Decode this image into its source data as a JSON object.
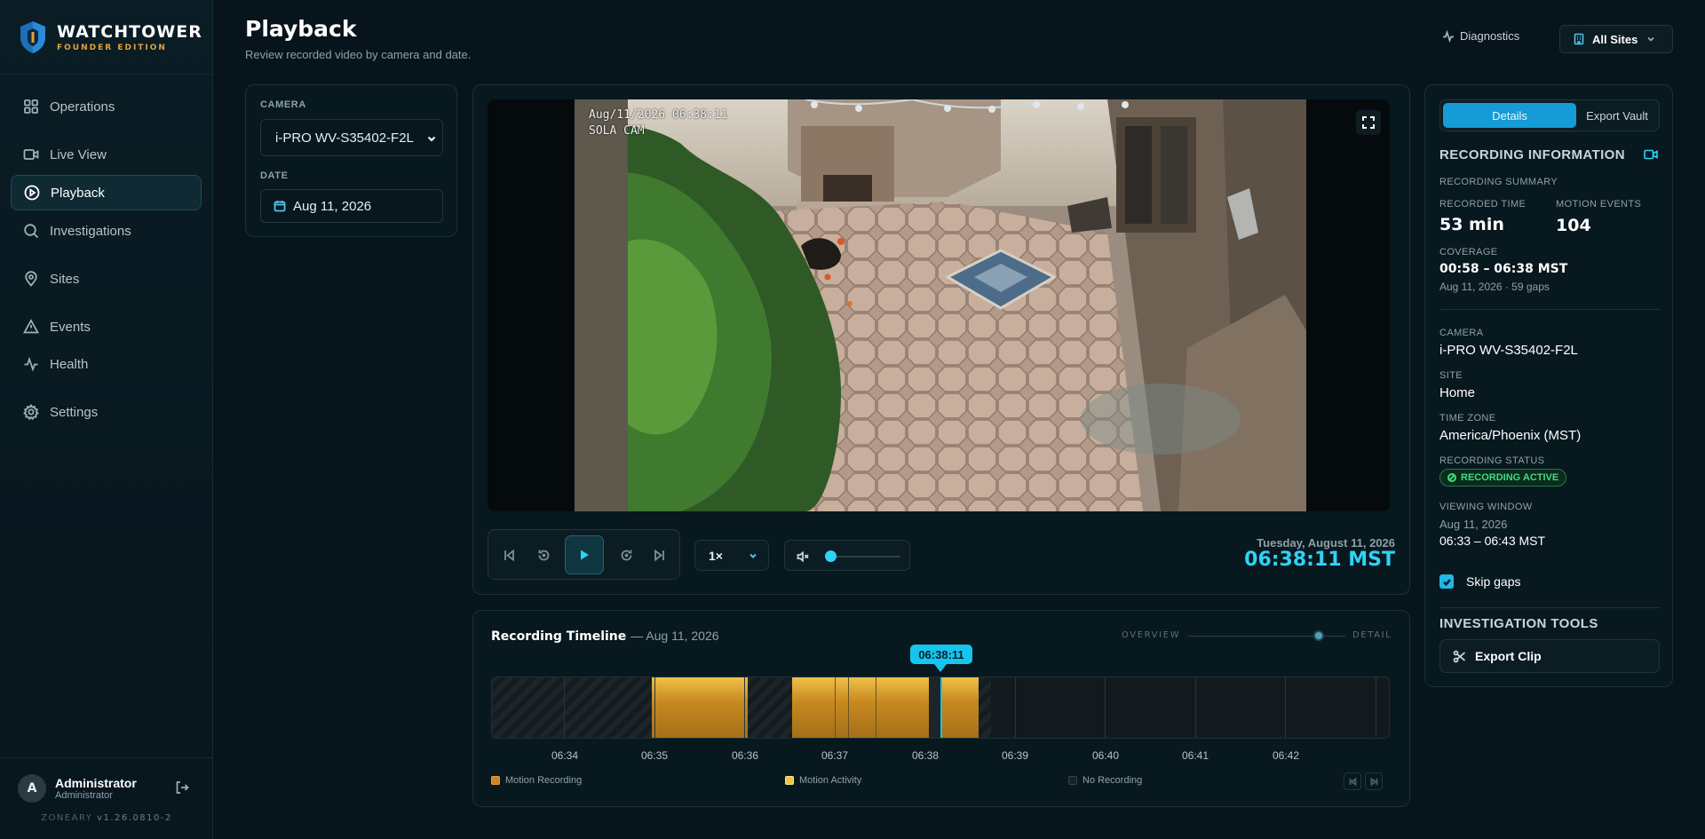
{
  "brand": {
    "name": "WATCHTOWER",
    "edition": "FOUNDER EDITION"
  },
  "nav": [
    {
      "label": "Operations",
      "icon": "grid-icon",
      "active": false
    },
    {
      "label": "Live View",
      "icon": "video-icon",
      "active": false
    },
    {
      "label": "Playback",
      "icon": "play-circle-icon",
      "active": true
    },
    {
      "label": "Investigations",
      "icon": "search-icon",
      "active": false
    },
    {
      "label": "Sites",
      "icon": "map-pin-icon",
      "active": false
    },
    {
      "label": "Events",
      "icon": "alert-triangle-icon",
      "active": false
    },
    {
      "label": "Health",
      "icon": "activity-icon",
      "active": false
    },
    {
      "label": "Settings",
      "icon": "gear-icon",
      "active": false
    }
  ],
  "user": {
    "initial": "A",
    "name": "Administrator",
    "role": "Administrator"
  },
  "version": {
    "org": "ZONEARY",
    "build": "v1.26.0810-2"
  },
  "header": {
    "title": "Playback",
    "subtitle": "Review recorded video by camera and date.",
    "diagnostics": "Diagnostics",
    "site_selector": "All Sites"
  },
  "filters": {
    "camera_label": "CAMERA",
    "camera_value": "i-PRO WV-S35402-F2L",
    "date_label": "DATE",
    "date_value": "Aug 11, 2026"
  },
  "video": {
    "osd_timestamp": "Aug/11/2026 06:38:11",
    "osd_name": "SOLA CAM"
  },
  "controls": {
    "speed": "1×",
    "volume_level": 0,
    "current_date": "Tuesday, August 11, 2026",
    "current_time": "06:38:11 MST"
  },
  "timeline": {
    "title": "Recording Timeline",
    "date": "— Aug 11, 2026",
    "overview_label": "OVERVIEW",
    "detail_label": "DETAIL",
    "playhead_label": "06:38:11",
    "ticks": [
      "06:34",
      "06:35",
      "06:36",
      "06:37",
      "06:38",
      "06:39",
      "06:40",
      "06:41",
      "06:42"
    ],
    "legend": {
      "motion_recording": "Motion Recording",
      "motion_activity": "Motion Activity",
      "no_recording": "No Recording"
    },
    "colors": {
      "motion_recording": "#c8891f",
      "motion_activity": "#f0c24a",
      "no_recording": "#1a2227",
      "playhead": "#16c4ee"
    }
  },
  "details": {
    "tab_details": "Details",
    "tab_export": "Export Vault",
    "section_title": "RECORDING INFORMATION",
    "summary_label": "RECORDING SUMMARY",
    "recorded_time_label": "RECORDED TIME",
    "recorded_time_value": "53 min",
    "motion_events_label": "MOTION EVENTS",
    "motion_events_value": "104",
    "coverage_label": "COVERAGE",
    "coverage_value": "00:58 – 06:38 MST",
    "coverage_sub": "Aug 11, 2026 · 59 gaps",
    "camera_label": "CAMERA",
    "camera_value": "i-PRO WV-S35402-F2L",
    "site_label": "SITE",
    "site_value": "Home",
    "timezone_label": "TIME ZONE",
    "timezone_value": "America/Phoenix (MST)",
    "status_label": "RECORDING STATUS",
    "status_value": "RECORDING ACTIVE",
    "window_label": "VIEWING WINDOW",
    "window_date": "Aug 11, 2026",
    "window_range": "06:33 – 06:43 MST",
    "skip_gaps": "Skip gaps",
    "tools_title": "INVESTIGATION TOOLS",
    "export_clip": "Export Clip"
  }
}
